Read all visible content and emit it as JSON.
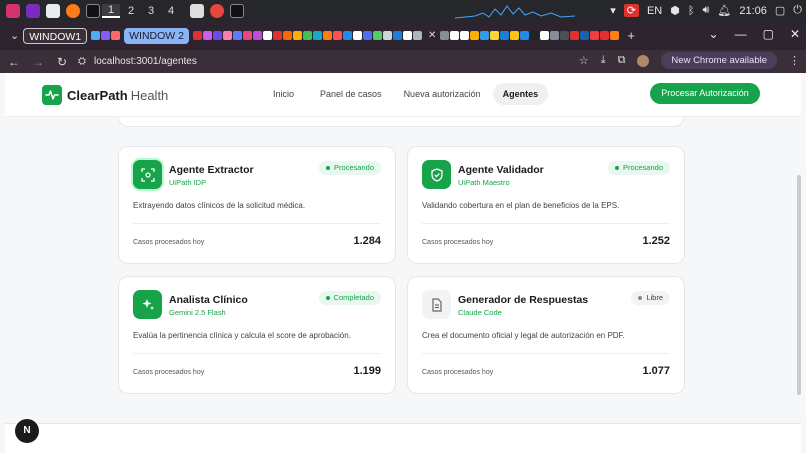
{
  "os": {
    "workspaces": [
      "1",
      "2",
      "3",
      "4"
    ],
    "active_workspace": "1",
    "lang": "EN",
    "time": "21:06"
  },
  "browser": {
    "tab_groups": [
      "WINDOW1",
      "WINDOW 2"
    ],
    "url": "localhost:3001/agentes",
    "new_chrome": "New Chrome available"
  },
  "site": {
    "brand": "ClearPath",
    "brand_sub": "Health",
    "nav": [
      "Inicio",
      "Panel de casos",
      "Nueva autorización",
      "Agentes"
    ],
    "active_nav": "Agentes",
    "cta": "Procesar Autorización"
  },
  "agents": [
    {
      "title": "Agente Extractor",
      "sub": "UiPath IDP",
      "status": "Procesando",
      "desc": "Extrayendo datos clínicos de la solicitud médica.",
      "metric_label": "Casos procesados hoy",
      "metric": "1.284",
      "icon": "scan-icon"
    },
    {
      "title": "Agente Validador",
      "sub": "UiPath Maestro",
      "status": "Procesando",
      "desc": "Validando cobertura en el plan de beneficios de la EPS.",
      "metric_label": "Casos procesados hoy",
      "metric": "1.252",
      "icon": "shield-check-icon"
    },
    {
      "title": "Analista Clínico",
      "sub": "Gemini 2.5 Flash",
      "status": "Completado",
      "desc": "Evalúa la pertinencia clínica y calcula el score de aprobación.",
      "metric_label": "Casos procesados hoy",
      "metric": "1.199",
      "icon": "sparkles-icon"
    },
    {
      "title": "Generador de Respuestas",
      "sub": "Claude Code",
      "status": "Libre",
      "desc": "Crea el documento oficial y legal de autorización en PDF.",
      "metric_label": "Casos procesados hoy",
      "metric": "1.077",
      "icon": "document-icon"
    }
  ],
  "dev_badge": "N",
  "colors": {
    "accent": "#16a34a",
    "header_bg": "#ffffff",
    "page_bg": "#f6f7f9"
  }
}
